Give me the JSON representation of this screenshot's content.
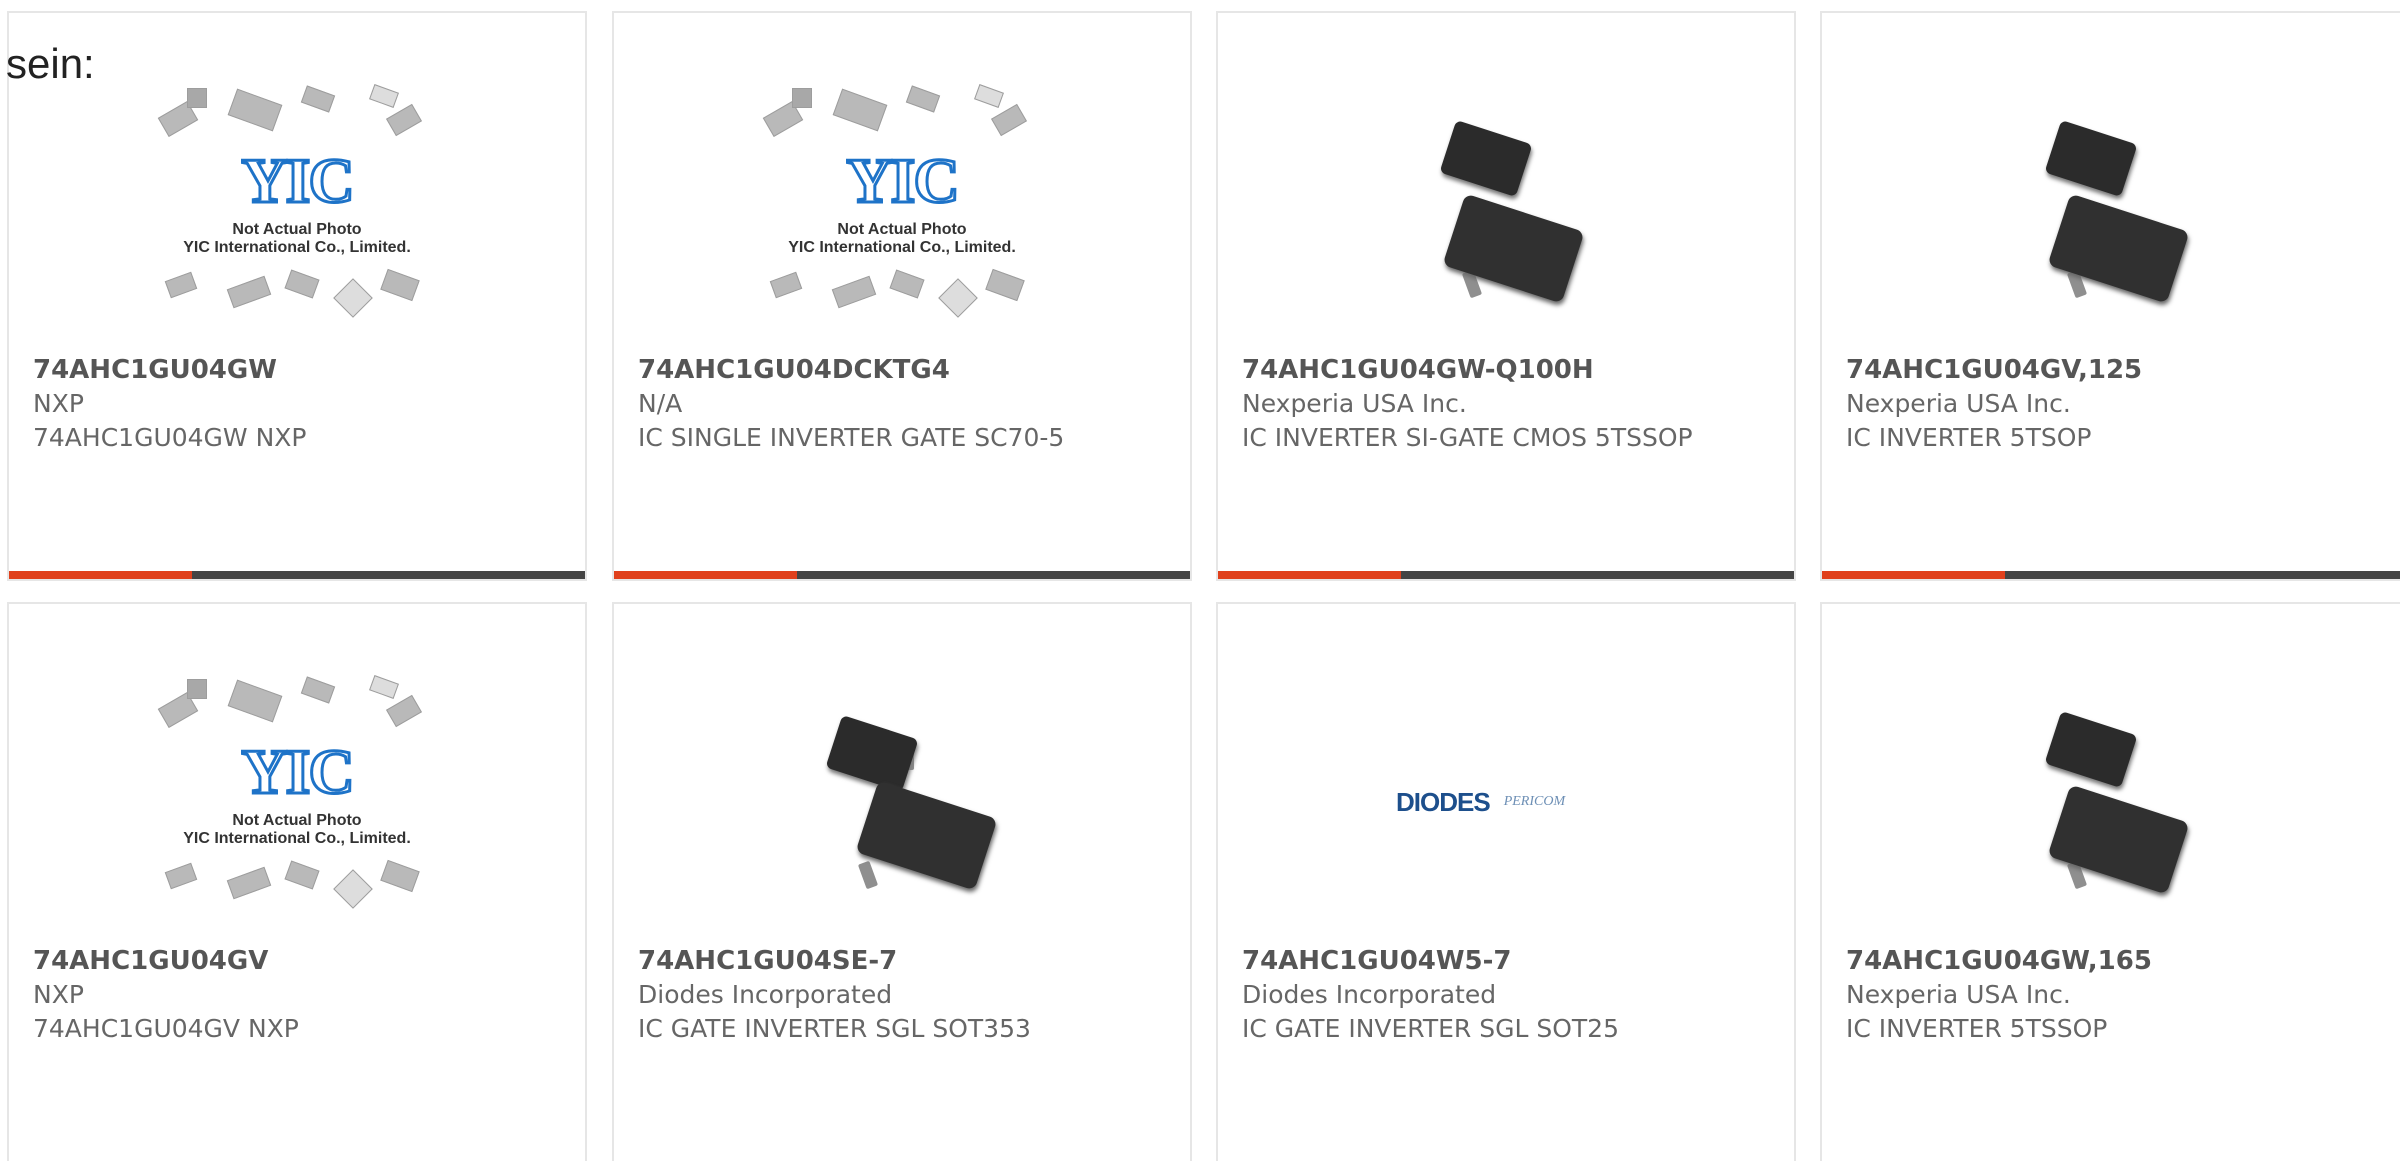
{
  "lead_text": "sein:",
  "placeholder": {
    "brand": "YIC",
    "line1": "Not Actual Photo",
    "line2": "YIC International Co., Limited."
  },
  "diodes_logo": {
    "left": "DIODES",
    "right": "PERICOM"
  },
  "colors": {
    "accent": "#e0401c",
    "bar": "#444444",
    "border": "#e6e6e6"
  },
  "products": [
    {
      "part": "74AHC1GU04GW",
      "manufacturer": "NXP",
      "description": "74AHC1GU04GW NXP",
      "image": "yic-placeholder"
    },
    {
      "part": "74AHC1GU04DCKTG4",
      "manufacturer": "N/A",
      "description": "IC SINGLE INVERTER GATE SC70-5",
      "image": "yic-placeholder"
    },
    {
      "part": "74AHC1GU04GW-Q100H",
      "manufacturer": "Nexperia USA Inc.",
      "description": "IC INVERTER SI-GATE CMOS 5TSSOP",
      "image": "sot-package-photo"
    },
    {
      "part": "74AHC1GU04GV,125",
      "manufacturer": "Nexperia USA Inc.",
      "description": "IC INVERTER 5TSOP",
      "image": "sot-package-photo"
    },
    {
      "part": "74AHC1GU04GV",
      "manufacturer": "NXP",
      "description": "74AHC1GU04GV NXP",
      "image": "yic-placeholder"
    },
    {
      "part": "74AHC1GU04SE-7",
      "manufacturer": "Diodes Incorporated",
      "description": "IC GATE INVERTER SGL SOT353",
      "image": "sot-package-photo"
    },
    {
      "part": "74AHC1GU04W5-7",
      "manufacturer": "Diodes Incorporated",
      "description": "IC GATE INVERTER SGL SOT25",
      "image": "diodes-logo"
    },
    {
      "part": "74AHC1GU04GW,165",
      "manufacturer": "Nexperia USA Inc.",
      "description": "IC INVERTER 5TSSOP",
      "image": "sot-package-photo"
    }
  ]
}
